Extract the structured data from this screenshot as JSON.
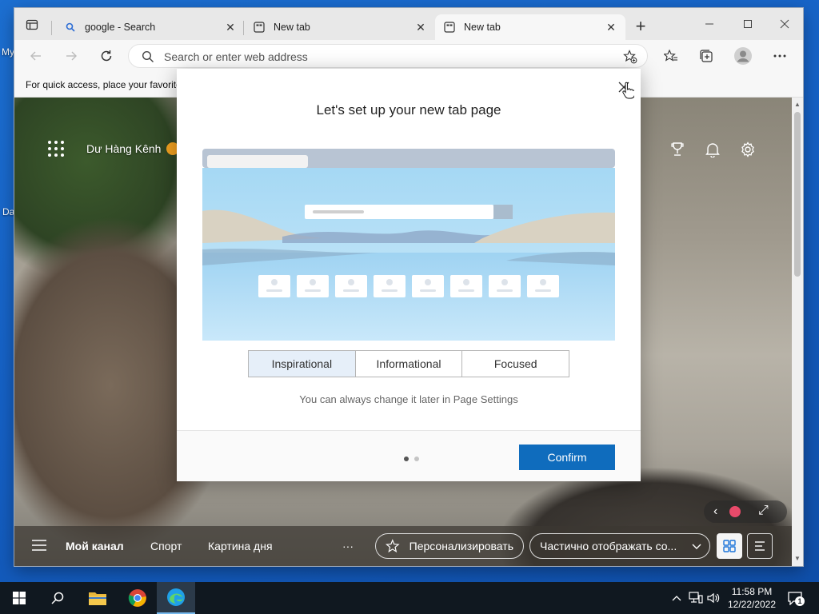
{
  "desktop": {
    "label_top": "My",
    "label_bottom": "Da"
  },
  "browser": {
    "tabs": [
      {
        "label": "google - Search",
        "icon": "search-icon"
      },
      {
        "label": "New tab",
        "icon": "newtab-page-icon"
      },
      {
        "label": "New tab",
        "icon": "newtab-page-icon"
      }
    ],
    "address_placeholder": "Search or enter web address",
    "favorites_bar_text": "For quick access, place your favorites here on the favorites bar."
  },
  "newtab": {
    "user_name": "Dư Hàng Kênh",
    "feed_nav": {
      "my_channel": "Мой канал",
      "sport": "Спорт",
      "picture_of_day": "Картина дня",
      "more": "···",
      "personalize": "Персонализировать",
      "display_mode": "Частично отображать со..."
    }
  },
  "modal": {
    "title": "Let's set up your new tab page",
    "layouts": [
      "Inspirational",
      "Informational",
      "Focused"
    ],
    "selected_layout": "Inspirational",
    "hint": "You can always change it later in Page Settings",
    "confirm_label": "Confirm",
    "page_indicator": {
      "current": 1,
      "total": 2
    }
  },
  "taskbar": {
    "apps": [
      "start-icon",
      "search-icon",
      "file-explorer-icon",
      "chrome-icon",
      "edge-icon"
    ],
    "time": "11:58 PM",
    "date": "12/22/2022",
    "notification_count": "1"
  },
  "colors": {
    "accent": "#0f6cbd",
    "selected_layout_bg": "#e6eff9"
  }
}
